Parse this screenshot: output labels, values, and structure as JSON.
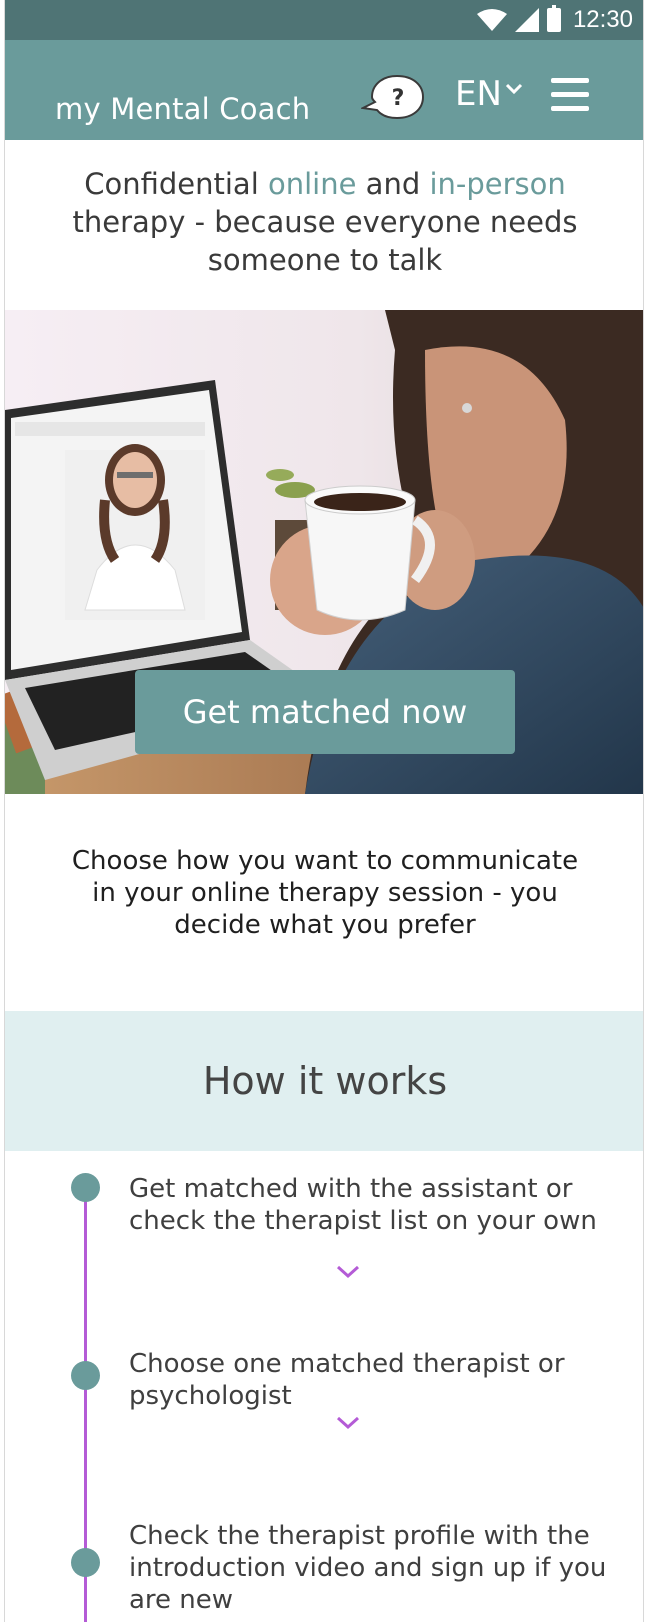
{
  "status_bar": {
    "time": "12:30"
  },
  "header": {
    "brand": "my Mental Coach",
    "help_icon_text": "?",
    "language": "EN"
  },
  "intro": {
    "part1": "Confidential ",
    "online": "online",
    "part2": " and ",
    "in_person": "in-person",
    "line2": "therapy - because everyone needs",
    "line3": "someone to talk"
  },
  "hero": {
    "cta_label": "Get matched now"
  },
  "choose_text": "Choose how you want to communicate in your online therapy session - you decide what you prefer",
  "how_it_works": {
    "title": "How it works",
    "steps": [
      {
        "text": "Get matched with the assistant or check the therapist list on your own"
      },
      {
        "text": "Choose one matched therapist or psychologist"
      },
      {
        "text": "Check the therapist profile with the introduction video and sign up if you are new"
      }
    ]
  },
  "colors": {
    "status_bar": "#4f7475",
    "app_bar": "#6a9b9b",
    "accent": "#6a9b9b",
    "section_bg": "#e0eff0",
    "timeline": "#b45bd6"
  },
  "icons": [
    "wifi-icon",
    "signal-icon",
    "battery-icon",
    "help-bubble-icon",
    "chevron-down-icon",
    "hamburger-menu-icon"
  ]
}
